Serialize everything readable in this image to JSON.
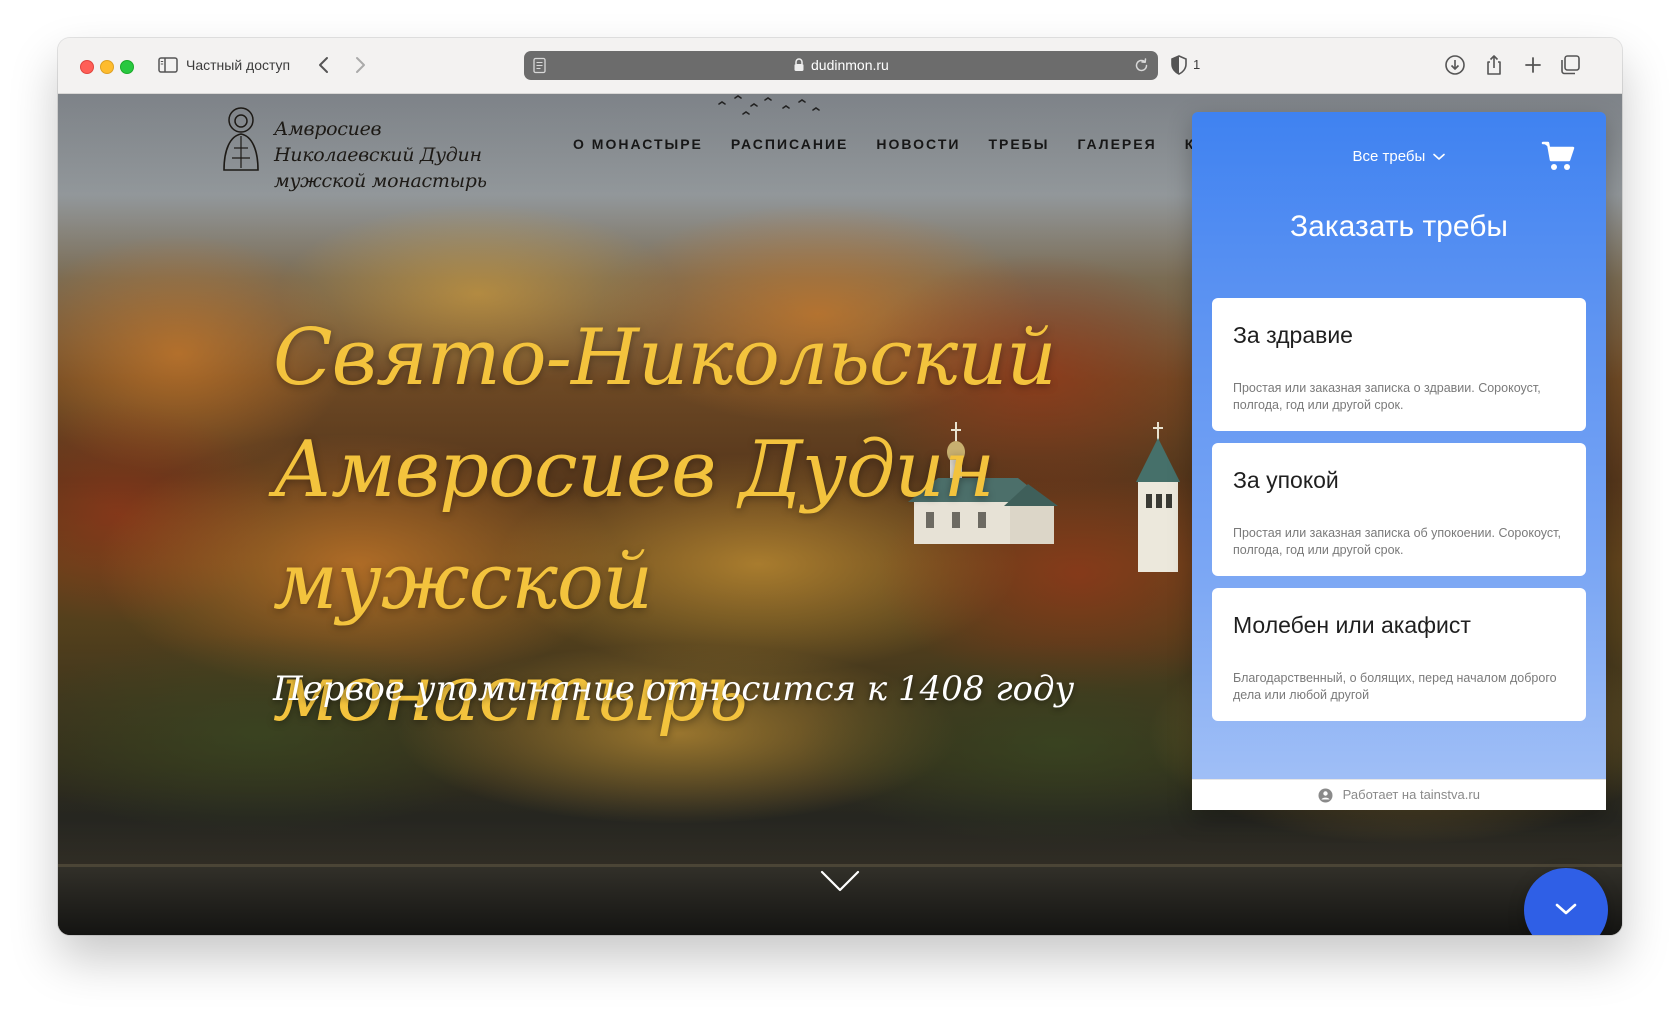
{
  "browser": {
    "private_label": "Частный доступ",
    "url": "dudinmon.ru",
    "shield_count": "1"
  },
  "site": {
    "logo_text": "Амвросиев Николаевский Дудин мужской монастырь",
    "nav": [
      "О МОНАСТЫРЕ",
      "РАСПИСАНИЕ",
      "НОВОСТИ",
      "ТРЕБЫ",
      "ГАЛЕРЕЯ",
      "КОН"
    ],
    "hero_title": "Свято-Никольский Амвросиев Дудин мужской монастырь",
    "hero_subtitle": "Первое упоминание относится к 1408 году"
  },
  "widget": {
    "filter_label": "Все требы",
    "title": "Заказать требы",
    "cards": [
      {
        "title": "За здравие",
        "desc": "Простая или заказная записка о здравии. Сорокоуст, полгода, год или другой срок."
      },
      {
        "title": "За упокой",
        "desc": "Простая или заказная записка об упокоении. Сорокоуст, полгода, год или другой срок."
      },
      {
        "title": "Молебен или акафист",
        "desc": "Благодарственный, о болящих, перед началом доброго дела или любой другой"
      }
    ],
    "footer": "Работает на tainstva.ru"
  },
  "colors": {
    "hero_title": "#f3c33d",
    "widget_top": "#3f82f1",
    "fab": "#2f5fe6"
  },
  "icons": [
    "sidebar-toggle-icon",
    "back-icon",
    "forward-icon",
    "reader-icon",
    "lock-icon",
    "reload-icon",
    "shield-icon",
    "download-icon",
    "share-icon",
    "new-tab-icon",
    "tabs-overview-icon",
    "cart-icon",
    "chevron-down-icon"
  ]
}
